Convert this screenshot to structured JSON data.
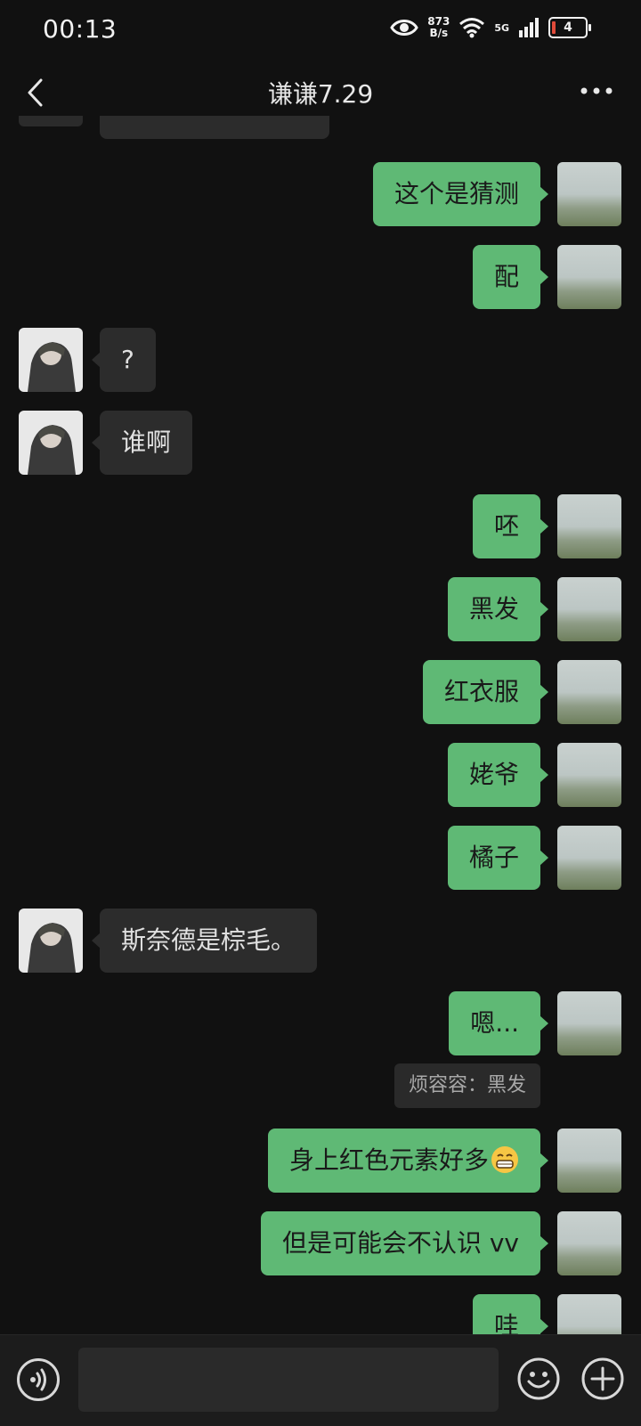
{
  "status_bar": {
    "time": "00:13",
    "speed_value": "873",
    "speed_unit": "B/s",
    "network": "5G",
    "battery": "4"
  },
  "header": {
    "title": "谦谦7.29"
  },
  "messages": [
    {
      "side": "me",
      "text": "这个是猜测"
    },
    {
      "side": "me",
      "text": "配"
    },
    {
      "side": "them",
      "text": "?"
    },
    {
      "side": "them",
      "text": "谁啊"
    },
    {
      "side": "me",
      "text": "呸"
    },
    {
      "side": "me",
      "text": "黑发"
    },
    {
      "side": "me",
      "text": "红衣服"
    },
    {
      "side": "me",
      "text": "姥爷"
    },
    {
      "side": "me",
      "text": "橘子"
    },
    {
      "side": "them",
      "text": "斯奈德是棕毛。"
    },
    {
      "side": "me",
      "text": "嗯..."
    },
    {
      "side": "me",
      "text": "身上红色元素好多",
      "emoji": "grinning-emoji"
    },
    {
      "side": "me",
      "text": "但是可能会不认识 vv"
    },
    {
      "side": "me",
      "text": "哇"
    }
  ],
  "quote": "烦容容：黑发",
  "colors": {
    "background": "#111111",
    "bubble_me": "#5fb975",
    "bubble_them": "#2c2c2c",
    "bottom_bar": "#1c1c1c"
  },
  "icons": [
    "back-icon",
    "more-icon",
    "voice-icon",
    "emoji-icon",
    "plus-icon",
    "eye-icon",
    "wifi-icon",
    "signal-icon",
    "battery-icon"
  ]
}
